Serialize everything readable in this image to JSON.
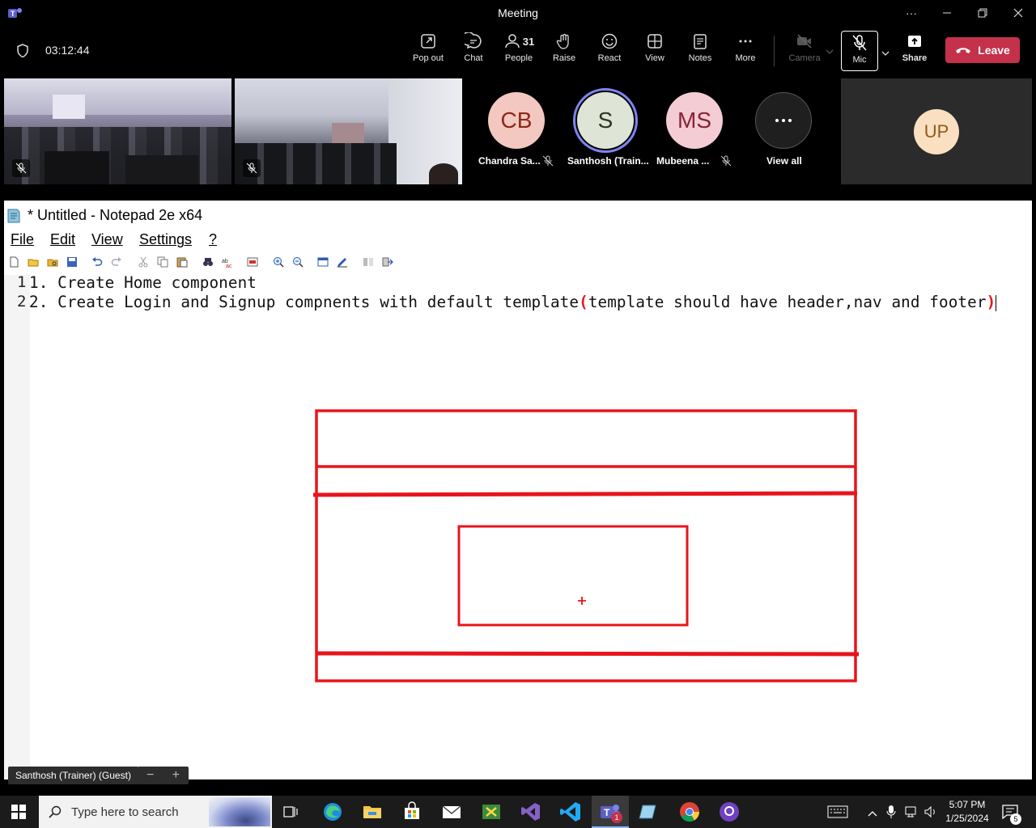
{
  "titlebar": {
    "title": "Meeting"
  },
  "meeting": {
    "timer": "03:12:44",
    "toolbar": {
      "popout": "Pop out",
      "chat": "Chat",
      "people": "People",
      "people_count": "31",
      "raise": "Raise",
      "react": "React",
      "view": "View",
      "notes": "Notes",
      "more": "More",
      "camera": "Camera",
      "mic": "Mic",
      "share": "Share",
      "leave": "Leave"
    },
    "participants": [
      {
        "initials": "CB",
        "name": "Chandra Sa...",
        "color": "#f3c8c0",
        "text_color": "#8b2a1a"
      },
      {
        "initials": "S",
        "name": "Santhosh (Train...",
        "color": "#dfe5d6",
        "text_color": "#2c3520"
      },
      {
        "initials": "MS",
        "name": "Mubeena ...",
        "color": "#f4cdd4",
        "text_color": "#8a2234"
      }
    ],
    "view_all": "View all",
    "self_initials": "UP",
    "presenter_label": "Santhosh (Trainer) (Guest)"
  },
  "notepad": {
    "title": "* Untitled - Notepad 2e x64",
    "menu": [
      "File",
      "Edit",
      "View",
      "Settings",
      "?"
    ],
    "lines": [
      {
        "num": "1",
        "text": "1. Create Home component"
      },
      {
        "num": "2",
        "text_before": "2. Create Login and Signup compnents with default template",
        "paren_open": "(",
        "text_mid": "template should have header,nav and footer",
        "paren_close": ")"
      }
    ],
    "annotation_color": "#e8141c"
  },
  "taskbar": {
    "search_placeholder": "Type here to search",
    "time": "5:07 PM",
    "date": "1/25/2024",
    "teams_badge": "1",
    "notif_badge": "5"
  }
}
